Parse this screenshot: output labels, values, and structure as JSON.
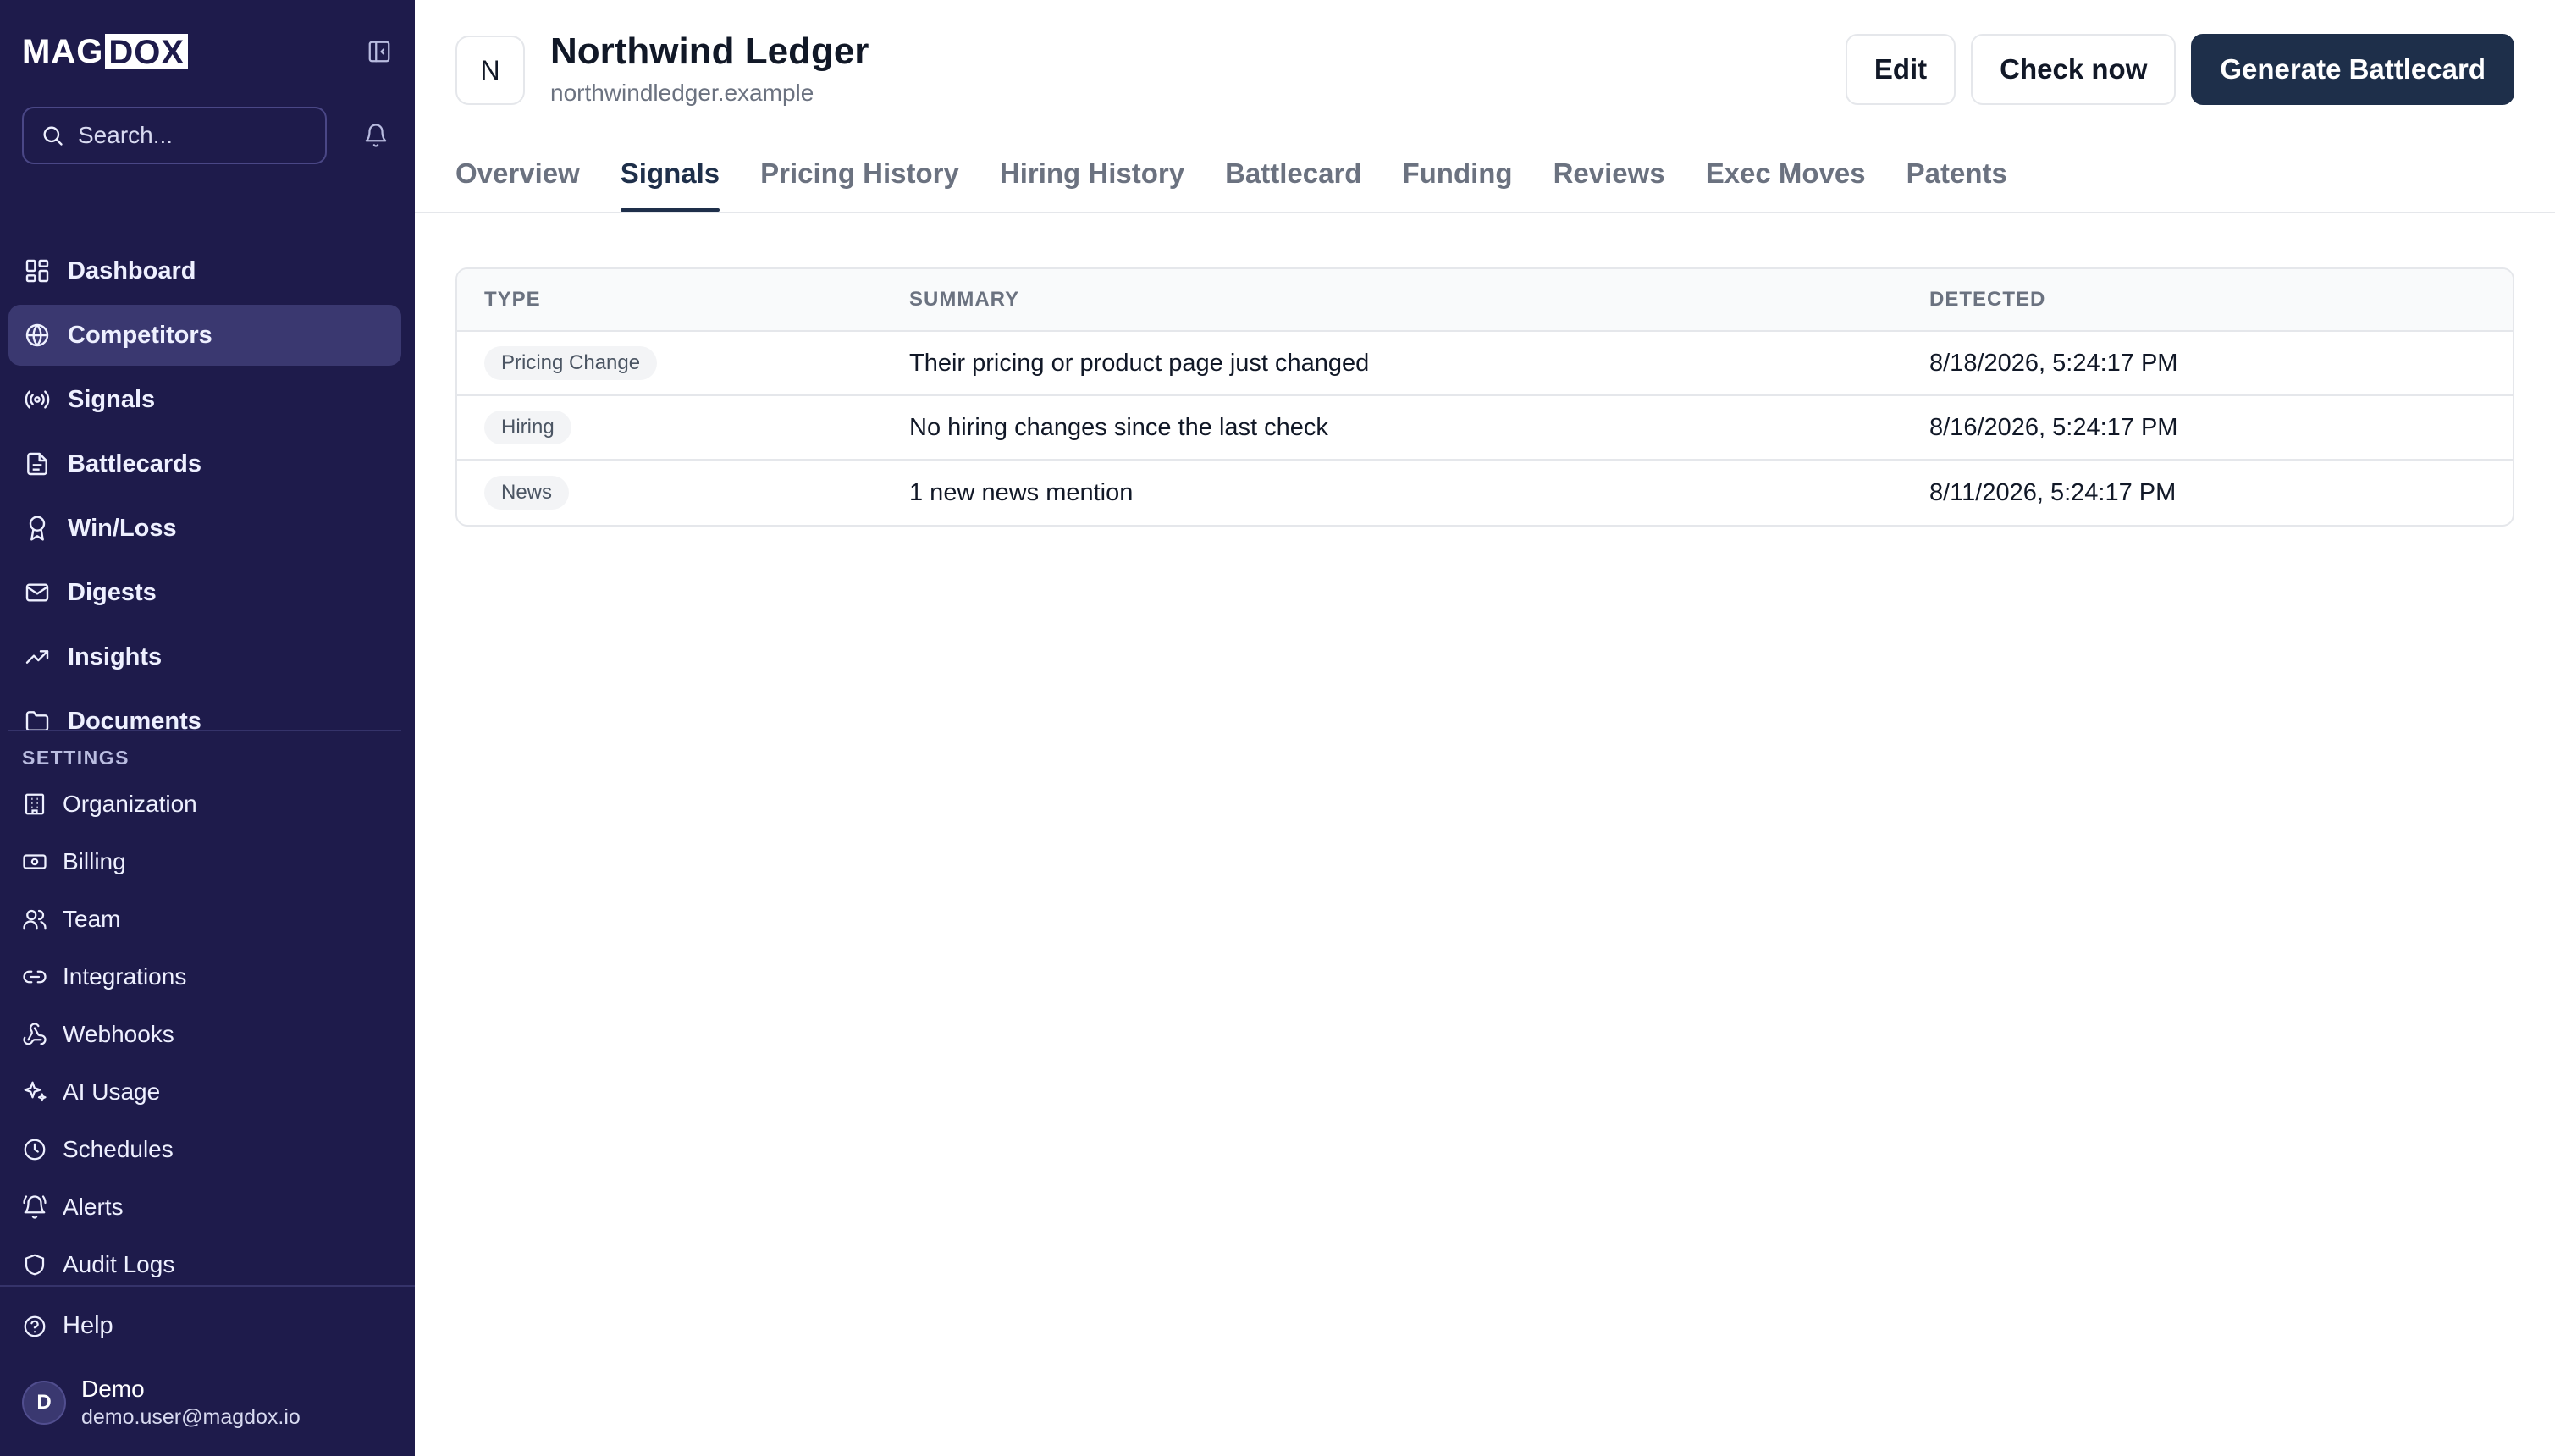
{
  "brand": {
    "part1": "MAG",
    "part2": "DOX"
  },
  "search": {
    "placeholder": "Search..."
  },
  "nav": [
    {
      "label": "Dashboard",
      "icon": "dashboard-icon",
      "active": false
    },
    {
      "label": "Competitors",
      "icon": "globe-icon",
      "active": true
    },
    {
      "label": "Signals",
      "icon": "radio-icon",
      "active": false
    },
    {
      "label": "Battlecards",
      "icon": "file-text-icon",
      "active": false
    },
    {
      "label": "Win/Loss",
      "icon": "award-icon",
      "active": false
    },
    {
      "label": "Digests",
      "icon": "mail-icon",
      "active": false
    },
    {
      "label": "Insights",
      "icon": "trending-up-icon",
      "active": false
    },
    {
      "label": "Documents",
      "icon": "folder-icon",
      "active": false
    }
  ],
  "settings": {
    "heading": "SETTINGS",
    "items": [
      {
        "label": "Organization",
        "icon": "building-icon"
      },
      {
        "label": "Billing",
        "icon": "banknote-icon"
      },
      {
        "label": "Team",
        "icon": "users-icon"
      },
      {
        "label": "Integrations",
        "icon": "link-icon"
      },
      {
        "label": "Webhooks",
        "icon": "webhook-icon"
      },
      {
        "label": "AI Usage",
        "icon": "sparkles-icon"
      },
      {
        "label": "Schedules",
        "icon": "clock-icon"
      },
      {
        "label": "Alerts",
        "icon": "bell-ring-icon"
      },
      {
        "label": "Audit Logs",
        "icon": "shield-icon"
      }
    ]
  },
  "help": {
    "label": "Help"
  },
  "user": {
    "initial": "D",
    "name": "Demo",
    "email": "demo.user@magdox.io"
  },
  "company": {
    "initial": "N",
    "name": "Northwind Ledger",
    "domain": "northwindledger.example"
  },
  "actions": {
    "edit": "Edit",
    "check": "Check now",
    "generate": "Generate Battlecard"
  },
  "tabs": [
    {
      "label": "Overview",
      "active": false
    },
    {
      "label": "Signals",
      "active": true
    },
    {
      "label": "Pricing History",
      "active": false
    },
    {
      "label": "Hiring History",
      "active": false
    },
    {
      "label": "Battlecard",
      "active": false
    },
    {
      "label": "Funding",
      "active": false
    },
    {
      "label": "Reviews",
      "active": false
    },
    {
      "label": "Exec Moves",
      "active": false
    },
    {
      "label": "Patents",
      "active": false
    }
  ],
  "table": {
    "headers": {
      "type": "TYPE",
      "summary": "SUMMARY",
      "detected": "DETECTED"
    },
    "rows": [
      {
        "type": "Pricing Change",
        "summary": "Their pricing or product page just changed",
        "detected": "8/18/2026, 5:24:17 PM"
      },
      {
        "type": "Hiring",
        "summary": "No hiring changes since the last check",
        "detected": "8/16/2026, 5:24:17 PM"
      },
      {
        "type": "News",
        "summary": "1 new news mention",
        "detected": "8/11/2026, 5:24:17 PM"
      }
    ]
  },
  "colors": {
    "sidebar": "#1e1b4b",
    "active_nav": "#3a3870",
    "primary": "#1e2f4a"
  }
}
